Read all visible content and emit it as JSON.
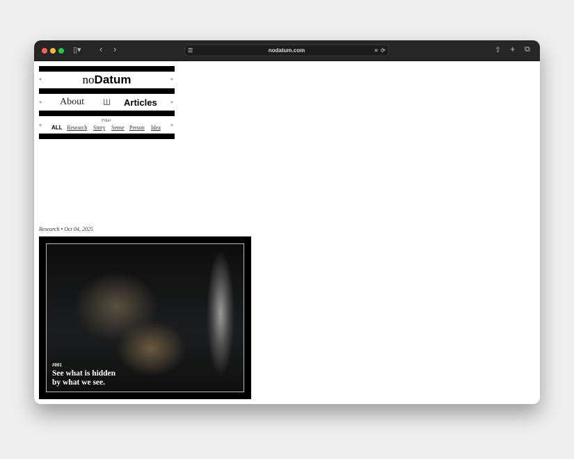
{
  "browser": {
    "url": "nodatum.com"
  },
  "site": {
    "logo_light": "no",
    "logo_bold": "Datum",
    "nav": {
      "about": "About",
      "articles": "Articles"
    },
    "star": "*",
    "filter_label": "Filter",
    "filters": [
      "ALL",
      "Research",
      "Story",
      "Sense",
      "Person",
      "Idea"
    ]
  },
  "article": {
    "meta": "Research • Oct 04, 2025",
    "number": "#001",
    "title_line1": "See what is hidden",
    "title_line2": "by what we see."
  },
  "colors": {
    "window": "#ffffff",
    "toolbar": "#262626",
    "background": "#efefef"
  }
}
